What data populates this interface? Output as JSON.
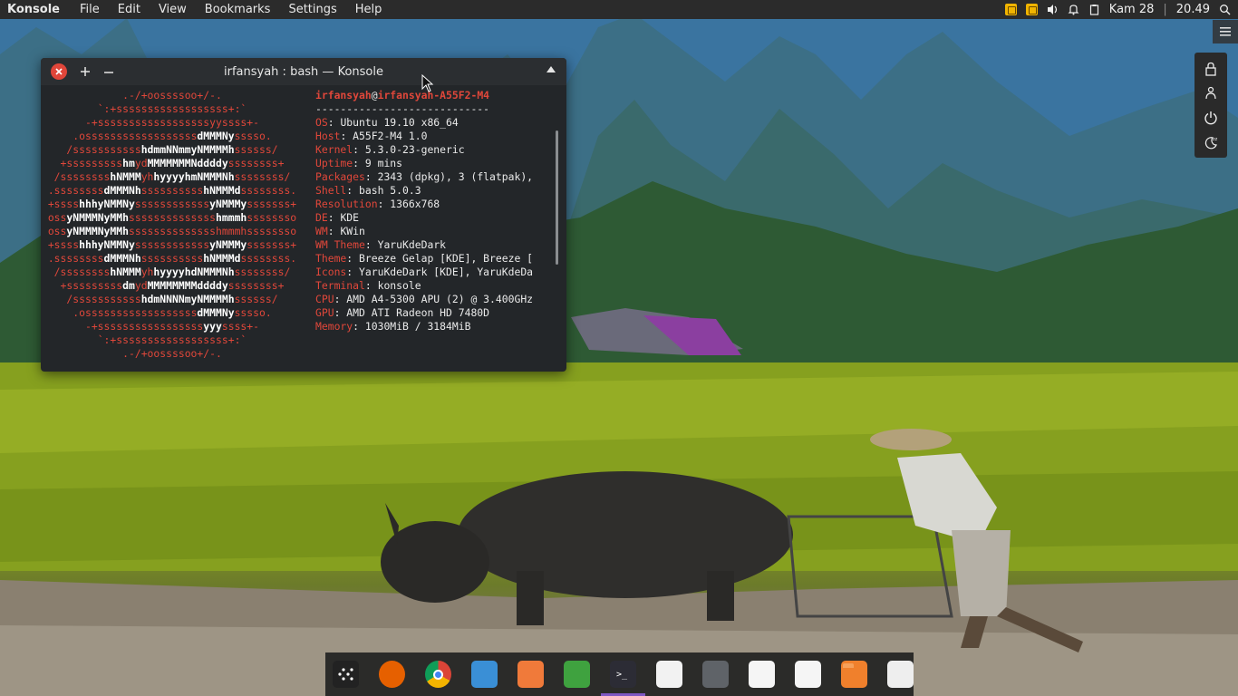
{
  "topbar": {
    "app_name": "Konsole",
    "menu": [
      "File",
      "Edit",
      "View",
      "Bookmarks",
      "Settings",
      "Help"
    ],
    "tray_icons": [
      "yellow-app-icon",
      "yellow-app-icon",
      "volume-icon",
      "notification-icon",
      "clipboard-icon"
    ],
    "date": "Kam 28",
    "time": "20.49"
  },
  "side_widget": {
    "buttons": [
      "lock-icon",
      "switch-user-icon",
      "power-icon",
      "sleep-icon"
    ]
  },
  "konsole": {
    "title": "irfansyah : bash — Konsole",
    "logo": [
      ".-/+oossssoo+/-.",
      "`:+ssssssssssssssssss+:`",
      "-+ssssssssssssssssssyyssss+-",
      ".ossssssssssssssssss<b>dMMMNy</b>sssso.",
      "/sssssssssss<b>hdmmNNmmyNMMMMh</b>ssssss/",
      "+sssssssss<b>hm</b>yd<b>MMMMMMMNddddy</b>ssssssss+",
      "/ssssssss<b>hNMMM</b>yh<b>hyyyyhmNMMMNh</b>ssssssss/",
      ".ssssssss<b>dMMMNh</b>ssssssssss<b>hNMMMd</b>ssssssss.",
      "+ssss<b>hhhyNMMNy</b>ssssssssssss<b>yNMMMy</b>sssssss+",
      "oss<b>yNMMMNyMMh</b>ssssssssssssss<b>hmmmh</b>ssssssso",
      "oss<b>yNMMMNyMMh</b>sssssssssssssshmmmhssssssso",
      "+ssss<b>hhhyNMMNy</b>ssssssssssss<b>yNMMMy</b>sssssss+",
      ".ssssssss<b>dMMMNh</b>ssssssssss<b>hNMMMd</b>ssssssss.",
      "/ssssssss<b>hNMMM</b>yh<b>hyyyyhdNMMMNh</b>ssssssss/",
      "+sssssssss<b>dm</b>yd<b>MMMMMMMMddddy</b>ssssssss+",
      "/sssssssssss<b>hdmNNNNmyNMMMMh</b>ssssss/",
      ".ossssssssssssssssss<b>dMMMNy</b>sssso.",
      "-+sssssssssssssssss<b>yyy</b>ssss+-",
      "`:+ssssssssssssssssss+:`",
      ".-/+oossssoo+/-."
    ],
    "user": "irfansyah",
    "at": "@",
    "host": "irfansyah-A55F2-M4",
    "separator": "----------------------------",
    "info": [
      {
        "key": "OS",
        "value": "Ubuntu 19.10 x86_64"
      },
      {
        "key": "Host",
        "value": "A55F2-M4 1.0"
      },
      {
        "key": "Kernel",
        "value": "5.3.0-23-generic"
      },
      {
        "key": "Uptime",
        "value": "9 mins"
      },
      {
        "key": "Packages",
        "value": "2343 (dpkg), 3 (flatpak),"
      },
      {
        "key": "Shell",
        "value": "bash 5.0.3"
      },
      {
        "key": "Resolution",
        "value": "1366x768"
      },
      {
        "key": "DE",
        "value": "KDE"
      },
      {
        "key": "WM",
        "value": "KWin"
      },
      {
        "key": "WM Theme",
        "value": "YaruKdeDark"
      },
      {
        "key": "Theme",
        "value": "Breeze Gelap [KDE], Breeze ["
      },
      {
        "key": "Icons",
        "value": "YaruKdeDark [KDE], YaruKdeDa"
      },
      {
        "key": "Terminal",
        "value": "konsole"
      },
      {
        "key": "CPU",
        "value": "AMD A4-5300 APU (2) @ 3.400GHz"
      },
      {
        "key": "GPU",
        "value": "AMD ATI Radeon HD 7480D"
      },
      {
        "key": "Memory",
        "value": "1030MiB / 3184MiB"
      }
    ],
    "palette": [
      "#e0191c",
      "#26a33a",
      "#f07a1a",
      "#2b8de0",
      "#9b59b6",
      "#1fae8f",
      "#ffffff"
    ]
  },
  "dock": {
    "items": [
      {
        "name": "launcher-icon",
        "color": "#222222"
      },
      {
        "name": "firefox-icon",
        "color": "#e66000"
      },
      {
        "name": "chrome-icon",
        "color": "#4caf50"
      },
      {
        "name": "system-settings-icon",
        "color": "#3a8fd6"
      },
      {
        "name": "software-center-icon",
        "color": "#f07a3a"
      },
      {
        "name": "spreadsheet-icon",
        "color": "#3fa23f"
      },
      {
        "name": "konsole-icon",
        "color": "#2c2c35",
        "active": true
      },
      {
        "name": "inkscape-icon",
        "color": "#f2f2f2"
      },
      {
        "name": "calculator-icon",
        "color": "#5f6368"
      },
      {
        "name": "text-editor-icon",
        "color": "#f5f5f5"
      },
      {
        "name": "gimp-icon",
        "color": "#f5f5f5"
      },
      {
        "name": "files-icon",
        "color": "#f0802c"
      },
      {
        "name": "blank-app-icon",
        "color": "#eeeeee"
      }
    ]
  }
}
